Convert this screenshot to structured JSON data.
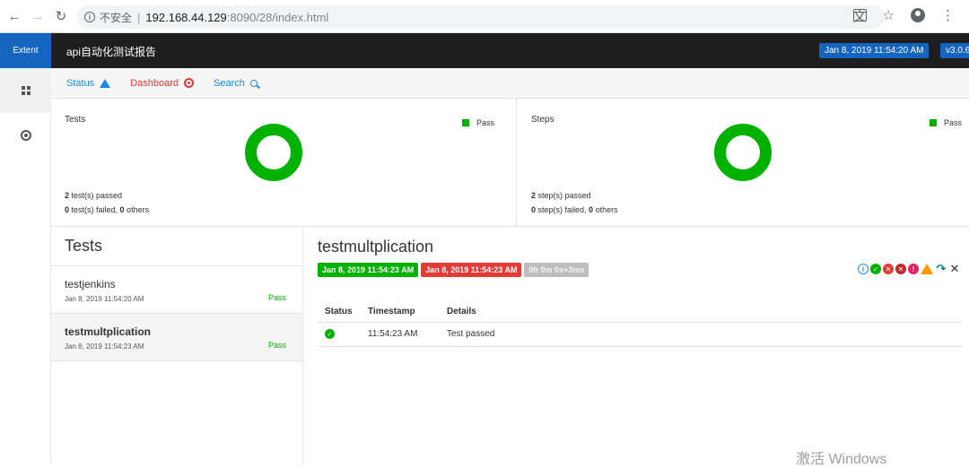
{
  "browser": {
    "security_label": "不安全",
    "url_host": "192.168.44.129",
    "url_path": ":8090/28/index.html"
  },
  "header": {
    "brand": "Extent",
    "report_title": "api自动化测试报告",
    "date": "Jan 8, 2019 11:54:20 AM",
    "version": "v3.0.6"
  },
  "subnav": {
    "status": "Status",
    "dashboard": "Dashboard",
    "search": "Search"
  },
  "dashboard": {
    "tests_panel": {
      "title": "Tests",
      "legend": "Pass",
      "passed_count": "2",
      "passed_text": " test(s) passed",
      "failed_count": "0",
      "failed_text": " test(s) failed, ",
      "others_count": "0",
      "others_text": " others"
    },
    "steps_panel": {
      "title": "Steps",
      "legend": "Pass",
      "passed_count": "2",
      "passed_text": " step(s) passed",
      "failed_count": "0",
      "failed_text": " step(s) failed, ",
      "others_count": "0",
      "others_text": " others"
    }
  },
  "test_list": {
    "title": "Tests",
    "items": [
      {
        "name": "testjenkins",
        "time": "Jan 8, 2019 11:54:20 AM",
        "status": "Pass"
      },
      {
        "name": "testmultplication",
        "time": "Jan 8, 2019 11:54:23 AM",
        "status": "Pass"
      }
    ]
  },
  "detail": {
    "title": "testmultplication",
    "start_time": "Jan 8, 2019 11:54:23 AM",
    "end_time": "Jan 8, 2019 11:54:23 AM",
    "duration": "0h 0m 0s+3ms",
    "columns": [
      "Status",
      "Timestamp",
      "Details"
    ],
    "rows": [
      {
        "status_icon": "check-circle-icon",
        "timestamp": "11:54:23 AM",
        "details": "Test passed"
      }
    ]
  },
  "watermark": "激活 Windows",
  "colors": {
    "pass": "#00b200",
    "fail": "#e53935",
    "accent": "#1565c0",
    "header_bg": "#1e1e1e"
  }
}
